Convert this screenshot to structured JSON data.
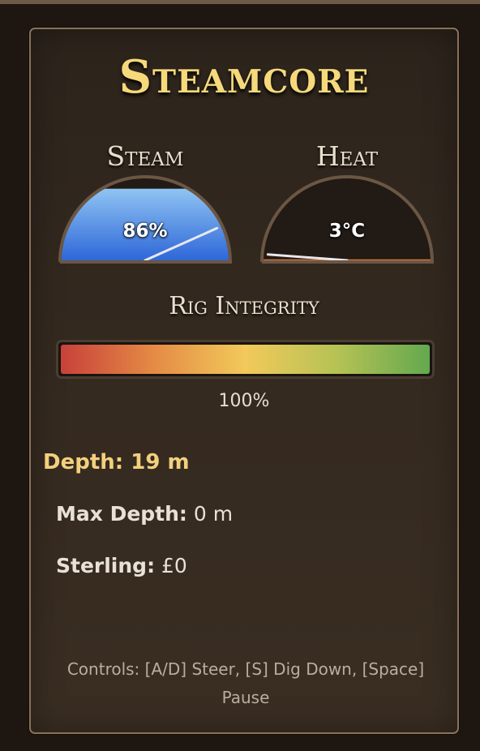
{
  "title": "Steamcore",
  "gauges": {
    "steam": {
      "label": "Steam",
      "readout": "86%",
      "level": 0.86,
      "fill_color": "#3d7fe0"
    },
    "heat": {
      "label": "Heat",
      "readout": "3°C",
      "level": 0.03,
      "fill_color": "#e07a3a"
    }
  },
  "integrity": {
    "label": "Rig Integrity",
    "value_text": "100%",
    "level": 1.0
  },
  "stats": {
    "depth": {
      "key": "Depth:",
      "value": "19 m"
    },
    "max_depth": {
      "key": "Max Depth:",
      "value": "0 m"
    },
    "sterling": {
      "key": "Sterling:",
      "value": "£0"
    }
  },
  "controls": "Controls: [A/D] Steer, [S] Dig Down, [Space] Pause",
  "colors": {
    "accent_gold": "#f6d97a",
    "panel_border": "#8a7158",
    "gauge_rim": "#6b5644"
  }
}
